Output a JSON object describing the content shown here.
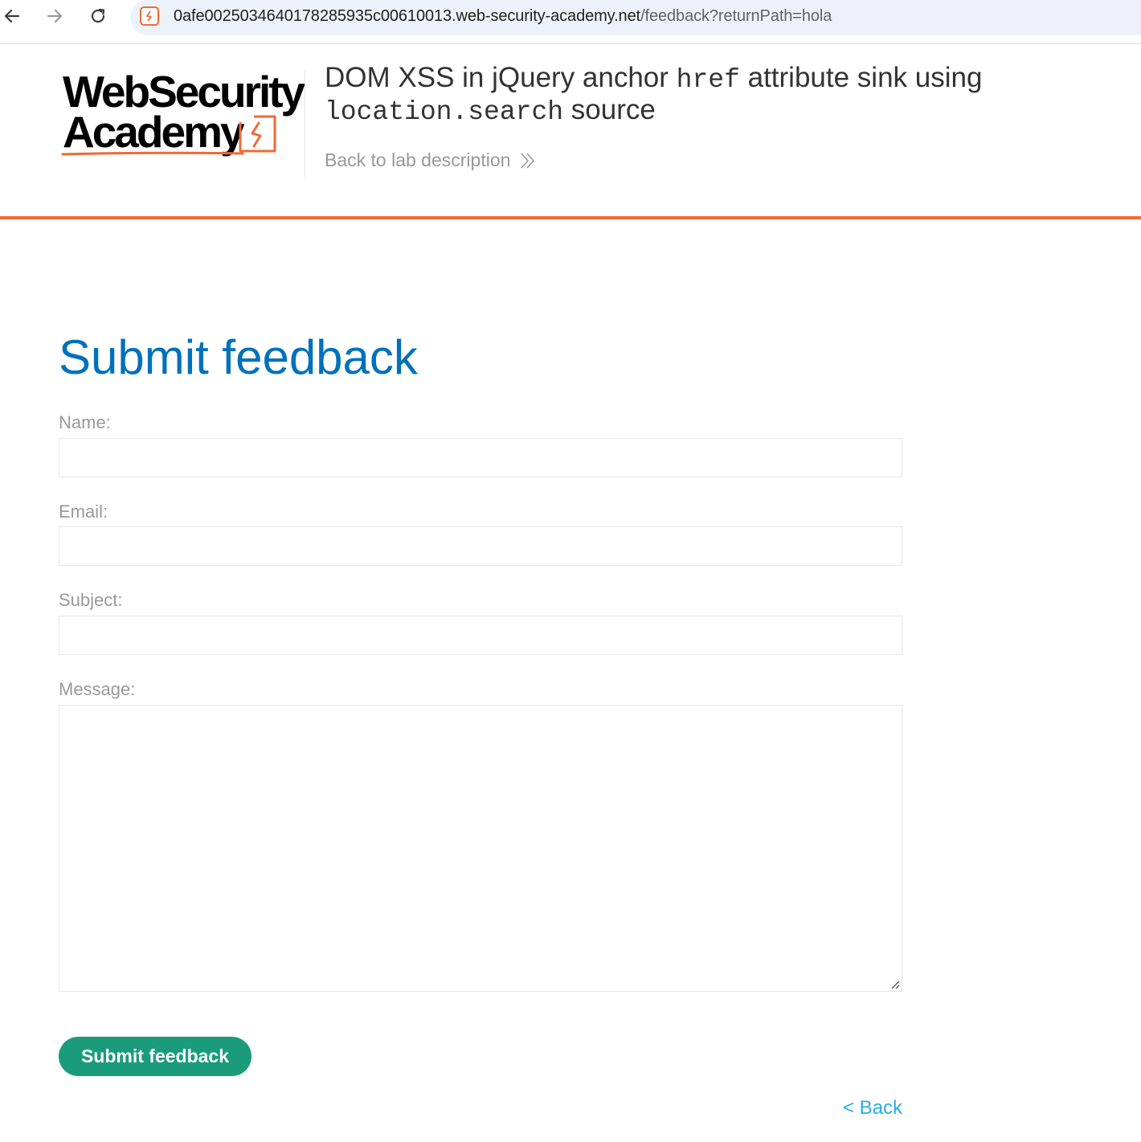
{
  "browser": {
    "url_host": "0afe00250346401782859 35c00610013.web-security-academy.net",
    "url_host_clean": "0afe002503464017828593 5c00610013.web-security-academy.net",
    "url_domain": "0afe0025034640178285935c00610013.web-security-academy.net",
    "url_path": "/feedback?returnPath=hola"
  },
  "header": {
    "logo_line1": "WebSecurity",
    "logo_line2": "Academy",
    "title_part1": "DOM XSS in jQuery anchor ",
    "title_code1": "href",
    "title_part2": " attribute sink using",
    "title_code2": "location.search",
    "title_part3": " source",
    "back_to_lab": "Back to lab description"
  },
  "main": {
    "title": "Submit feedback",
    "form": {
      "name_label": "Name:",
      "name_value": "",
      "email_label": "Email:",
      "email_value": "",
      "subject_label": "Subject:",
      "subject_value": "",
      "message_label": "Message:",
      "message_value": "",
      "submit_label": "Submit feedback"
    },
    "back_link": "< Back"
  },
  "colors": {
    "accent_orange": "#f26a35",
    "title_blue": "#0071bc",
    "button_green": "#1a9c7a",
    "link_blue": "#29abe2"
  }
}
